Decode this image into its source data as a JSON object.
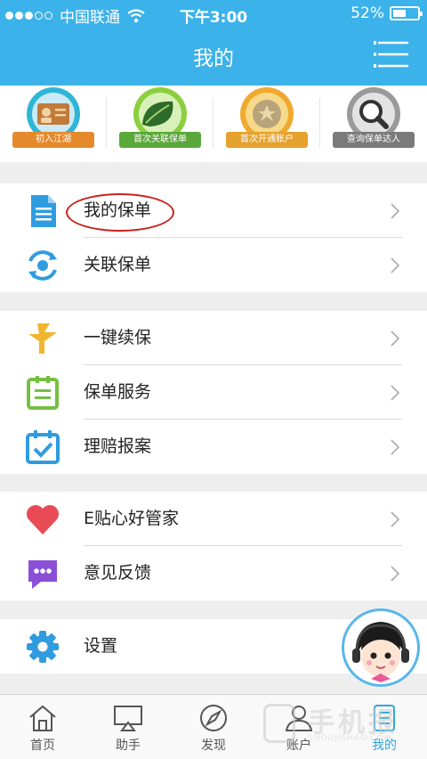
{
  "status_bar": {
    "carrier": "中国联通",
    "time": "下午3:00",
    "battery": "52%",
    "battery_level": 0.52,
    "signal_bars": 3,
    "signal_total": 5
  },
  "nav": {
    "title": "我的",
    "menu_icon": "list-menu-icon"
  },
  "badges": [
    {
      "label": "初入江湖",
      "icon": "id-card-icon",
      "color": "#e58a2c"
    },
    {
      "label": "首次关联保单",
      "icon": "leaf-icon",
      "color": "#5ba83a"
    },
    {
      "label": "首次开通账户",
      "icon": "coin-icon",
      "color": "#e5a22c"
    },
    {
      "label": "查询保单达人",
      "icon": "magnifier-icon",
      "color": "#7a7a7a"
    }
  ],
  "groups": [
    {
      "items": [
        {
          "label": "我的保单",
          "icon": "document-icon"
        },
        {
          "label": "关联保单",
          "icon": "refresh-link-icon"
        }
      ]
    },
    {
      "items": [
        {
          "label": "一键续保",
          "icon": "renew-icon"
        },
        {
          "label": "保单服务",
          "icon": "clipboard-icon"
        },
        {
          "label": "理赔报案",
          "icon": "calendar-check-icon"
        }
      ]
    },
    {
      "items": [
        {
          "label": "E贴心好管家",
          "icon": "heart-icon"
        },
        {
          "label": "意见反馈",
          "icon": "chat-bubble-icon"
        }
      ]
    },
    {
      "items": [
        {
          "label": "设置",
          "icon": "gear-icon"
        }
      ]
    }
  ],
  "tabs": [
    {
      "label": "首页",
      "icon": "home-icon"
    },
    {
      "label": "助手",
      "icon": "airplay-icon"
    },
    {
      "label": "发现",
      "icon": "compass-icon"
    },
    {
      "label": "账户",
      "icon": "user-icon"
    },
    {
      "label": "我的",
      "icon": "mine-icon"
    }
  ],
  "active_tab": "我的",
  "watermark": {
    "brand": "手机报",
    "sub": "SHOUJISHAO.COM"
  },
  "colors": {
    "primary": "#3cb2ea",
    "accent_red": "#c9231f",
    "tab_active": "#2ea7e0"
  }
}
